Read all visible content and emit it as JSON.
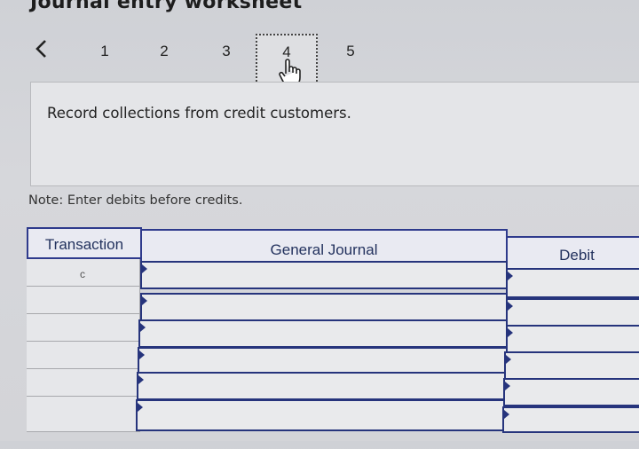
{
  "header": {
    "title": "Journal entry worksheet"
  },
  "pager": {
    "prev_icon": "chevron-left-icon",
    "pages": [
      "1",
      "2",
      "3",
      "4",
      "5"
    ],
    "current": "4"
  },
  "instruction": {
    "text": "Record collections from credit customers."
  },
  "note": {
    "text": "Note: Enter debits before credits."
  },
  "table": {
    "columns": [
      "Transaction",
      "General Journal",
      "Debit"
    ],
    "rows": [
      {
        "transaction": "c"
      },
      {
        "transaction": ""
      },
      {
        "transaction": ""
      },
      {
        "transaction": ""
      },
      {
        "transaction": ""
      },
      {
        "transaction": ""
      }
    ]
  },
  "colors": {
    "border_blue": "#26347c",
    "header_text": "#23325e"
  }
}
